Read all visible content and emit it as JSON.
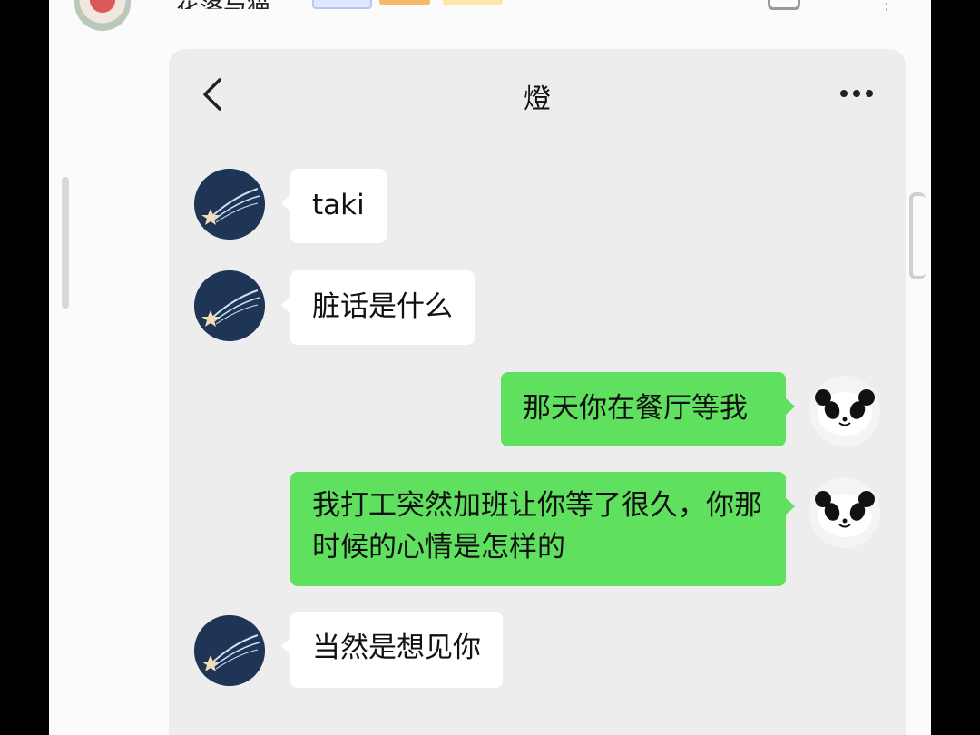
{
  "post": {
    "author_name": "花落与猫"
  },
  "chat": {
    "title": "燈",
    "messages": [
      {
        "side": "in",
        "text": "taki"
      },
      {
        "side": "in",
        "text": "脏话是什么"
      },
      {
        "side": "out",
        "text": "那天你在餐厅等我"
      },
      {
        "side": "out",
        "text": "我打工突然加班让你等了很久，你那时候的心情是怎样的"
      },
      {
        "side": "in",
        "text": "当然是想见你"
      }
    ]
  },
  "icons": {
    "back": "chevron-left-icon",
    "more": "more-horizontal-icon",
    "contact_avatar": "shooting-star-avatar",
    "self_avatar": "panda-avatar"
  },
  "colors": {
    "outgoing_bubble": "#5fe05f",
    "incoming_bubble": "#ffffff",
    "chat_background": "#ededed"
  }
}
